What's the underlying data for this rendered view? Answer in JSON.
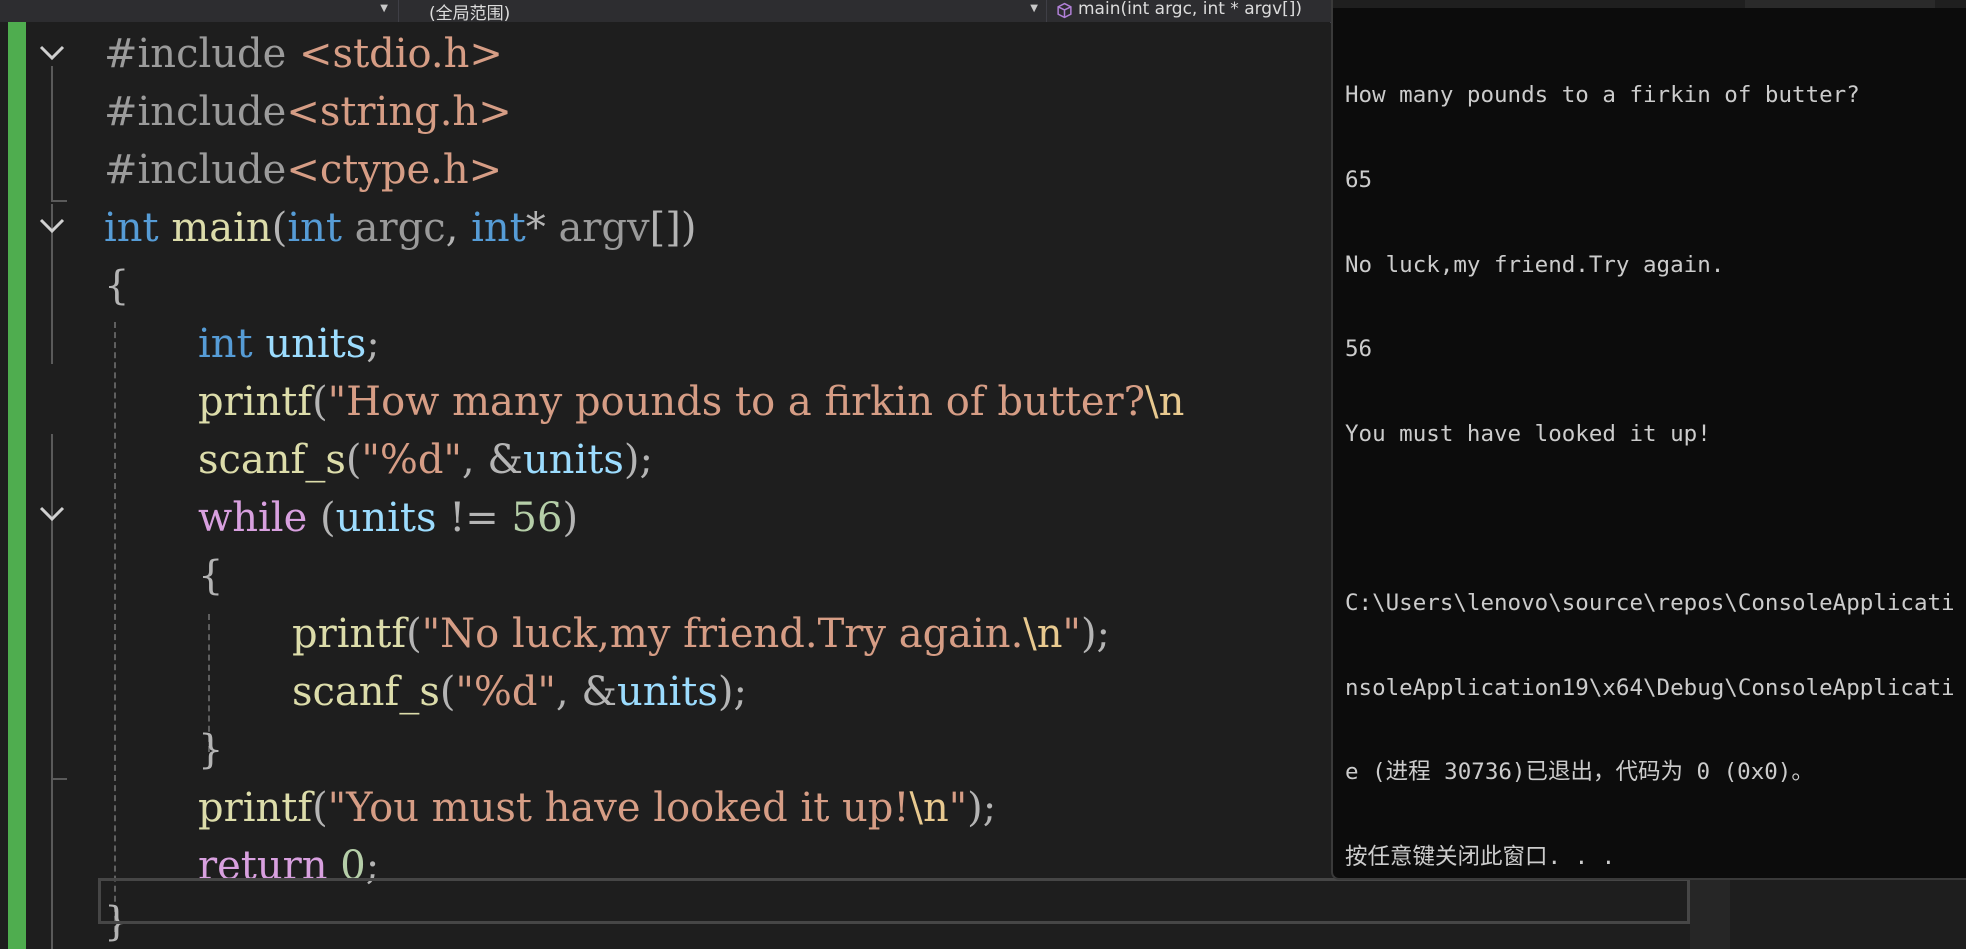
{
  "navbar": {
    "scope_label": "(全局范围)",
    "function_label": "main(int argc, int * argv[])",
    "dropdown_icon": "caret-down",
    "function_icon": "cube-icon"
  },
  "editor": {
    "lines": {
      "l1": {
        "directive": "#include",
        "header": "<stdio.h>"
      },
      "l2": {
        "directive": "#include",
        "header": "<string.h>"
      },
      "l3": {
        "directive": "#include",
        "header": "<ctype.h>"
      },
      "l4": {
        "kw_int": "int",
        "fn_main": "main",
        "lp": "(",
        "kw_int2": "int",
        "param_argc": "argc",
        "comma": ",",
        "kw_int3": "int",
        "star": "*",
        "param_argv": "argv",
        "rest": "[])"
      },
      "l5": {
        "brace": "{"
      },
      "l6": {
        "kw_int": "int",
        "var": "units",
        "semi": ";"
      },
      "l7": {
        "fn": "printf",
        "lp": "(",
        "str": "\"How many pounds to a firkin of butter?",
        "esc": "\\n"
      },
      "l8": {
        "fn": "scanf_s",
        "lp": "(",
        "str": "\"%d\"",
        "comma": ", &",
        "var": "units",
        "rp": ");"
      },
      "l9": {
        "kw": "while",
        "lp": " (",
        "var": "units",
        "op": " != ",
        "num": "56",
        "rp": ")"
      },
      "l10": {
        "brace": "{"
      },
      "l11": {
        "fn": "printf",
        "lp": "(",
        "str": "\"No luck,my friend.Try again.",
        "esc": "\\n",
        "str_end": "\"",
        "rp": ");"
      },
      "l12": {
        "fn": "scanf_s",
        "lp": "(",
        "str": "\"%d\"",
        "comma": ", &",
        "var": "units",
        "rp": ");"
      },
      "l13": {
        "brace": "}"
      },
      "l14": {
        "fn": "printf",
        "lp": "(",
        "str": "\"You must have looked it up!",
        "esc": "\\n",
        "str_end": "\"",
        "rp": ");"
      },
      "l15": {
        "kw": "return",
        "num": "0",
        "semi": ";"
      },
      "l16": {
        "brace": "}"
      }
    },
    "colors": {
      "change_bar": "#4fad4f",
      "keyword": "#569cd6",
      "function": "#dcdcaa",
      "string": "#d69d85",
      "variable": "#9cdcfe",
      "control": "#d8a0df",
      "number": "#b5cea8"
    }
  },
  "console": {
    "lines": [
      "How many pounds to a firkin of butter?",
      "65",
      "No luck,my friend.Try again.",
      "56",
      "You must have looked it up!",
      "",
      "C:\\Users\\lenovo\\source\\repos\\ConsoleApplicati",
      "nsoleApplication19\\x64\\Debug\\ConsoleApplicati",
      "e (进程 30736)已退出，代码为 0 (0x0)。",
      "按任意键关闭此窗口. . ."
    ]
  }
}
